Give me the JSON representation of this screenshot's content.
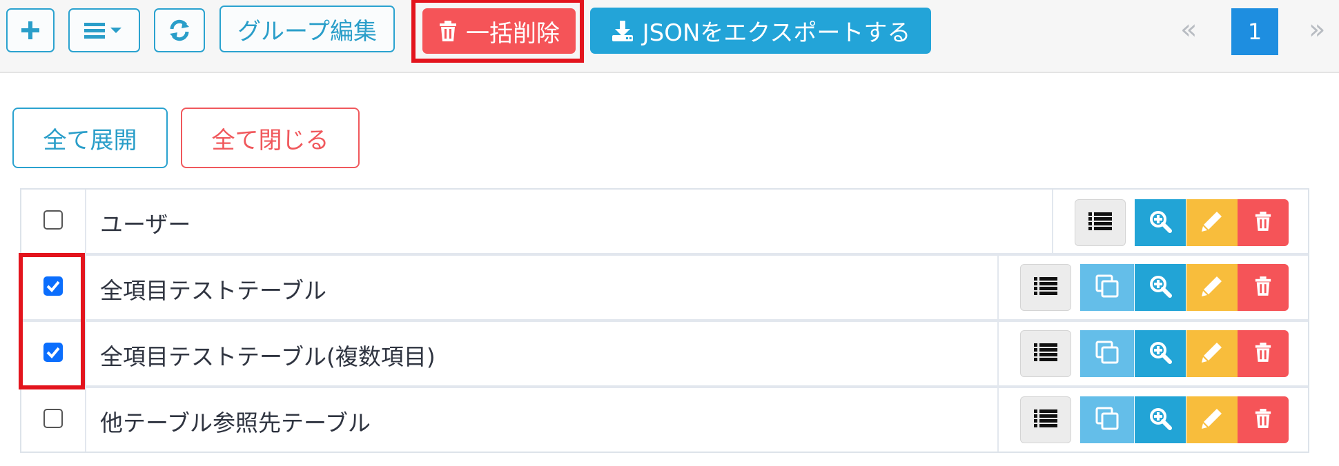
{
  "toolbar": {
    "add_icon": "plus-icon",
    "menu_icon": "bars-caret-icon",
    "refresh_icon": "refresh-icon",
    "group_edit_label": "グループ編集",
    "bulk_delete_label": "一括削除",
    "export_label": "JSONをエクスポートする"
  },
  "pagination": {
    "prev": "«",
    "current": "1",
    "next": "»"
  },
  "controls": {
    "expand_all": "全て展開",
    "collapse_all": "全て閉じる"
  },
  "rows": [
    {
      "label": "ユーザー",
      "checked": false,
      "has_copy": false
    },
    {
      "label": "全項目テストテーブル",
      "checked": true,
      "has_copy": true
    },
    {
      "label": "全項目テストテーブル(複数項目)",
      "checked": true,
      "has_copy": true
    },
    {
      "label": "他テーブル参照先テーブル",
      "checked": false,
      "has_copy": true
    }
  ],
  "colors": {
    "accent_blue": "#23a4d8",
    "danger_red": "#f55458",
    "warning_yellow": "#f8bd3c",
    "light_blue": "#64bee9",
    "highlight_red": "#e3141d",
    "page_active": "#1e8ee0"
  }
}
